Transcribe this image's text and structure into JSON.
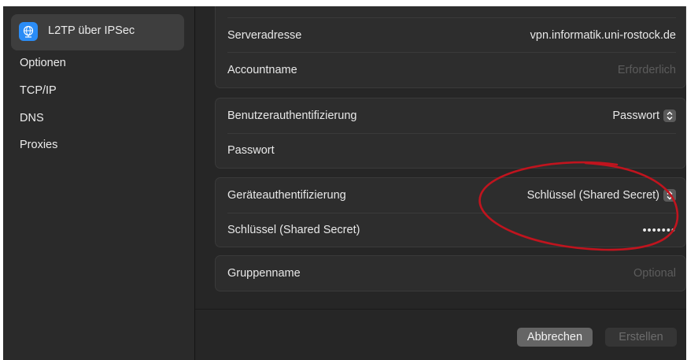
{
  "sidebar": {
    "selected": {
      "label": "L2TP über IPSec",
      "icon": "globe-icon"
    },
    "items": [
      "Optionen",
      "TCP/IP",
      "DNS",
      "Proxies"
    ]
  },
  "server_group": {
    "server_address": {
      "label": "Serveradresse",
      "value": "vpn.informatik.uni-rostock.de"
    },
    "account_name": {
      "label": "Accountname",
      "placeholder": "Erforderlich"
    }
  },
  "auth_group": {
    "user_auth": {
      "label": "Benutzerauthentifizierung",
      "value": "Passwort"
    },
    "password": {
      "label": "Passwort"
    }
  },
  "device_group": {
    "device_auth": {
      "label": "Geräteauthentifizierung",
      "value": "Schlüssel (Shared Secret)"
    },
    "shared_secret": {
      "label": "Schlüssel (Shared Secret)",
      "value": "•••••••"
    }
  },
  "group_name": {
    "label": "Gruppenname",
    "placeholder": "Optional"
  },
  "buttons": {
    "cancel": "Abbrechen",
    "create": "Erstellen"
  },
  "colors": {
    "accent": "#2a8cf6",
    "annotation": "#c0141e"
  }
}
